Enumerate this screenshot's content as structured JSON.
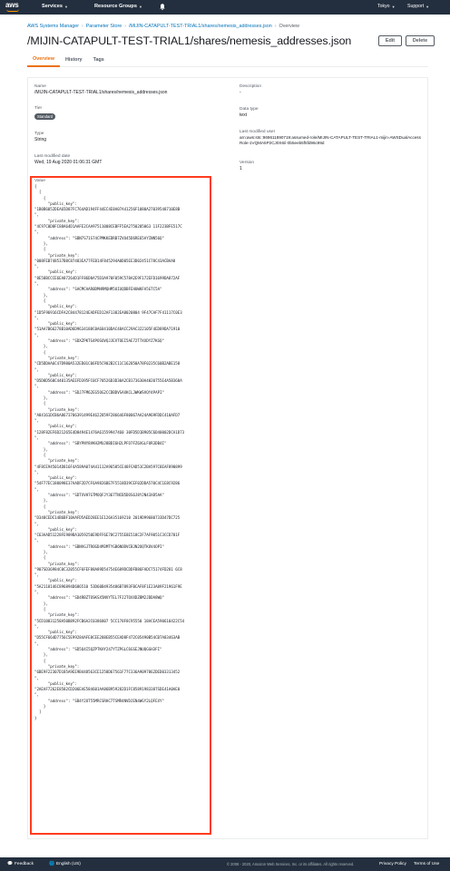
{
  "topnav": {
    "brand": "aws",
    "services": "Services",
    "resource_groups": "Resource Groups",
    "region": "Tokyo",
    "support": "Support"
  },
  "breadcrumb": {
    "items": [
      "AWS Systems Manager",
      "Parameter Store",
      "/MIJIN-CATAPULT-TEST-TRIAL1/shares/nemesis_addresses.json"
    ],
    "current": "Overview"
  },
  "page": {
    "title": "/MIJIN-CATAPULT-TEST-TRIAL1/shares/nemesis_addresses.json",
    "edit_label": "Edit",
    "delete_label": "Delete"
  },
  "tabs": [
    "Overview",
    "History",
    "Tags"
  ],
  "details": {
    "name_label": "Name",
    "name_value": "/MIJIN-CATAPULT-TEST-TRIAL1/shares/nemesis_addresses.json",
    "tier_label": "Tier",
    "tier_value": "Standard",
    "type_label": "Type",
    "type_value": "String",
    "last_modified_date_label": "Last modified date",
    "last_modified_date_value": "Wed, 19 Aug 2020 01:06:31 GMT",
    "description_label": "Description",
    "description_value": "-",
    "data_type_label": "Data type",
    "data_type_value": "text",
    "last_modified_user_label": "Last modified user",
    "last_modified_user_value": "arn:aws:sts::969611890719:assumed-role/MIJIN-CATAPULT-TEST-TRIAL1-mijin-AWSDualAccessRole-1VQMA5P2CJ0X6/i-0b5eeb5f5fd96c99d",
    "version_label": "Version",
    "version_value": "1",
    "value_label": "Value"
  },
  "json_value": "{\n  [\n    {\n      \"public_key\":\n\"1B0B6052DEA65D87FC764AD194FF44EC4E8A07A41256F1080A27039548710E8B\n\",\n      \"private_key\":\n\"4C97C0D8FC88A64D1AAFE2CAA97511008CEBFF5EA2750205063 11F223BFE517C\n\",\n      \"address\": \"SBN7S71S74CPMKKEDRB7ZVU45D6RE65AYINN56Q\"\n    },\n    {\n      \"private_key\":\n\"008FEB748537B8C87483EA77FEB14F845294A0D05EE3D02451C78C43ACBAA8\n\",\n      \"public_key\":\n\"8E58BCCCE6EA87264D1FF86D8A75D3A970F059C578A2E9F172EFD1699DA872AF\n\",\n      \"address\": \"SACMCAAR0DMHRMQHM5UIUQDBFEHUWKFA5GTC5A\"\n    },\n    {\n      \"public_key\":\n\"1D5F96916CDFA2C84478124EADFED12AF1382EA8020804 9F47CAF7F41117C0E3\n\",\n      \"public_key\":\n\"51AA7B66278B10AD6D9634188C0A68410DAC48ACC29AC322105F4ED89DA71910\n\",\n      \"address\": \"SDXZPKTG4POSOVQJJEVTOEI5AE72T7XXDYZ7KGQ\"\n    },\n    {\n      \"private_key\":\n\"CD5DDAA6C47D980A532ED01C06FD5C902B2C11C162850A78F0235C60B2ABE158\n\",\n      \"public_key\":\n\"D5D8D560C440135AEEFD395FC0CF70526D3D30A2CB173630A4020755E4A5B368A\n\",\n      \"address\": \"SDJ7FM62EG5OG2CCDBDVSAXKCLJWKWSVQY4PAPI\"\n    },\n    {\n      \"private_key\":\n\"A84161DCB6A8673706391499E4622859F286646F80067AA24A969FDDC410AFD7\n\",\n      \"public_key\":\n\"128F82EF6D21265E4D8494E1476A61559947460 30FD5D1B905C6D40002DCA1D73\n\",\n      \"address\": \"SBYPNY8VKH2MUJ8BDI6H2LPFO7FZ6XGLFUR3DB4I\"\n    },\n    {\n      \"private_key\":\n\"4F8CE945014D816F4A589A074A41112A96585CE48FCAD51C2BA597C8EAF890899\n\",\n      \"public_key\":\n\"54F77EC188098E37AADF2D7CF6A9826BE7F5518D39CEF02DDA570C4C1E8C9286\n\",\n      \"address\": \"SDTXVH7GTMOQFJY367TNCB5DOS6J8YJN43X85AA\"\n    },\n    {\n      \"private_key\":\n\"D348CEDC14B6BF10AAFD5AED28EE1E126A35169210 2019D99680733D47DC725\n\",\n      \"public_key\":\n\"C63AAD51228FE909BA1059250E9DFF6E78C2755E8E518C2F7AF9051C3CCD701F\n\",\n      \"address\": \"SBNVGJTROGD4M3MTYGB6NODVCBJN2OQTKOV4OPI\"\n    },\n    {\n      \"private_key\":\n\"907SD36984C0C32055CF6FEF88A89D54754E689DCDDFB86FADC75174FD281 6C8\n\",\n      \"public_key\":\n\"5A2118146C896894D686510 53D60B4935486B7893FBCAF8F1E23A89F21961F9E\n\",\n      \"address\": \"SD4RBZTOSKSX5NVYTEL7FJ2TOXXDZBM2JDDA8WQ\"\n    },\n    {\n      \"private_key\":\n\"5CD18831258A50B892FCB6A2C0386807 5CC178F8C95550 18ACEA590610422C54\n\",\n      \"public_key\":\n\"D55CF664D7756C5E99284AFE8CEE288EB55CEAD8F472C05490B54CB7A83463AB\n\",\n      \"address\": \"SD5Q4I5QZPTKHY247YTZPGLC6GSEJNUQGGH3FI\"\n    },\n    {\n      \"private_key\":\n\"6BE9F22307D185A9EE9B448563CE1258D67561F77C336A9097862DED03313452\n\",\n      \"public_key\":\n\"2AEAF7262E8582CD206EAE584601AA86B959282D1FC85891983387SDE41A0AE0\n\",\n      \"address\": \"SB4Y2OT55MRCSRHC7TSMR4NVDJEN4WGY2LQFEXY\"\n    }\n  ]\n}",
  "footer": {
    "feedback": "Feedback",
    "language": "English (US)",
    "copyright": "© 2008 - 2020, Amazon Web Services, Inc. or its affiliates. All rights reserved.",
    "privacy": "Privacy Policy",
    "terms": "Terms of Use"
  }
}
